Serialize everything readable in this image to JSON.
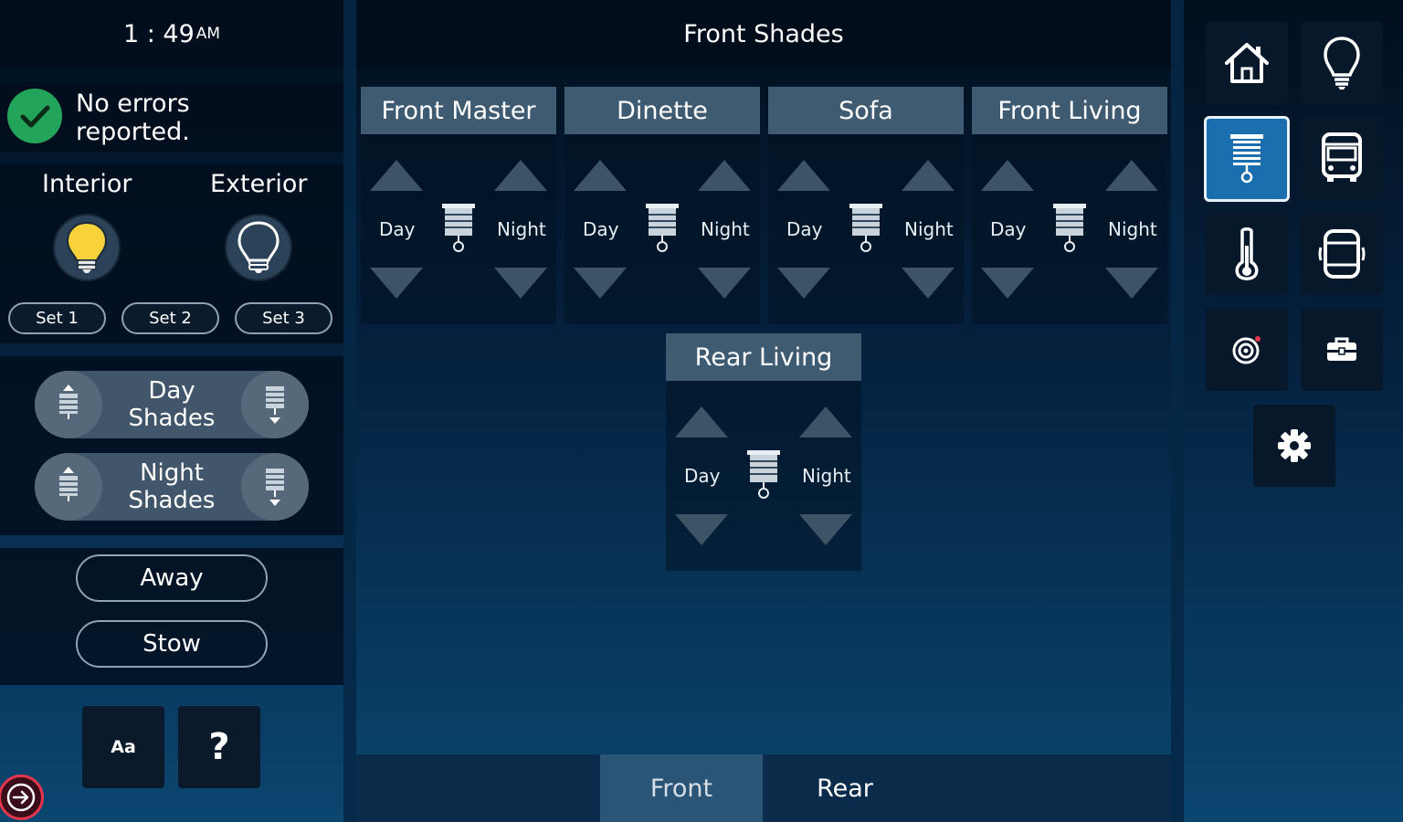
{
  "clock": {
    "time": "1 : 49",
    "ampm": "AM"
  },
  "status": {
    "line1": "No errors",
    "line2": "reported."
  },
  "lighting": {
    "interior_label": "Interior",
    "exterior_label": "Exterior",
    "sets": [
      "Set 1",
      "Set 2",
      "Set 3"
    ]
  },
  "shade_groups": {
    "day": {
      "line1": "Day",
      "line2": "Shades"
    },
    "night": {
      "line1": "Night",
      "line2": "Shades"
    }
  },
  "modes": {
    "away": "Away",
    "stow": "Stow"
  },
  "utility": {
    "font_size": "Aa",
    "help": "?"
  },
  "page": {
    "title": "Front Shades"
  },
  "card_labels": {
    "day": "Day",
    "night": "Night"
  },
  "shades": [
    {
      "name": "Front Master"
    },
    {
      "name": "Dinette"
    },
    {
      "name": "Sofa"
    },
    {
      "name": "Front Living"
    },
    {
      "name": "Rear Living"
    }
  ],
  "tabs": {
    "front": "Front",
    "rear": "Rear",
    "active": "Front"
  },
  "nav": [
    "home-icon",
    "lightbulb-icon",
    "shade-icon",
    "vehicle-icon",
    "thermometer-icon",
    "slideout-icon",
    "target-icon",
    "toolbox-icon",
    "gear-icon"
  ],
  "colors": {
    "status_ok": "#22a55b",
    "bulb_on": "#f7d23a",
    "nav_selected": "#1b6fae",
    "exit_accent": "#e3364c"
  }
}
